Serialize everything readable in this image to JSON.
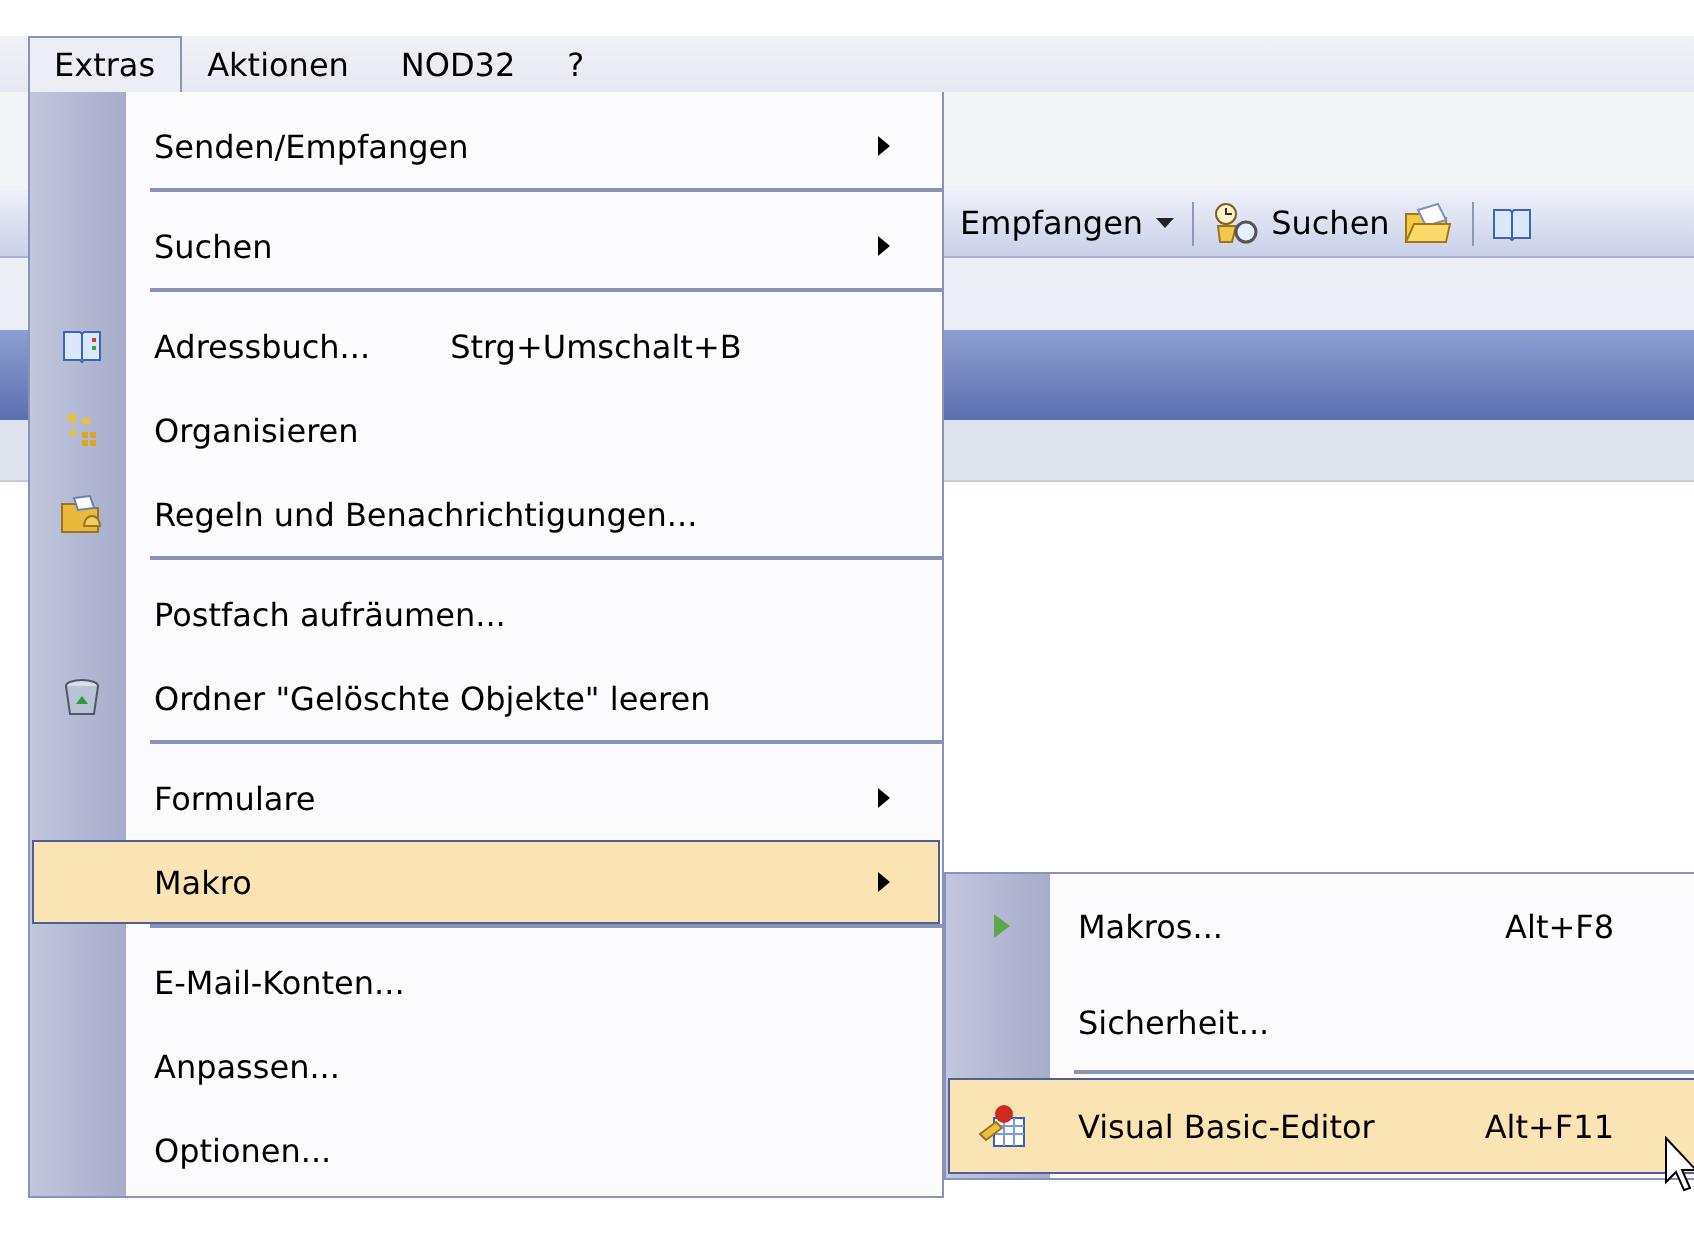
{
  "menubar": [
    {
      "label": "Extras",
      "selected": true
    },
    {
      "label": "Aktionen",
      "selected": false
    },
    {
      "label": "NOD32",
      "selected": false
    },
    {
      "label": "?",
      "selected": false
    }
  ],
  "toolbar": {
    "receive_label": "Empfangen",
    "search_label": "Suchen"
  },
  "menu": [
    {
      "label": "Senden/Empfangen",
      "kind": "submenu",
      "selected": false,
      "separator_after": true
    },
    {
      "label": "Suchen",
      "kind": "submenu",
      "selected": false,
      "separator_after": true
    },
    {
      "label": "Adressbuch...",
      "shortcut": "Strg+Umschalt+B",
      "kind": "command",
      "selected": false,
      "separator_after": false
    },
    {
      "label": "Organisieren",
      "kind": "command",
      "selected": false,
      "separator_after": false
    },
    {
      "label": "Regeln und Benachrichtigungen...",
      "kind": "command",
      "selected": false,
      "separator_after": true
    },
    {
      "label": "Postfach aufräumen...",
      "kind": "command",
      "selected": false,
      "separator_after": false
    },
    {
      "label": "Ordner \"Gelöschte Objekte\" leeren",
      "kind": "command",
      "selected": false,
      "separator_after": true
    },
    {
      "label": "Formulare",
      "kind": "submenu",
      "selected": false,
      "separator_after": false
    },
    {
      "label": "Makro",
      "kind": "submenu",
      "selected": true,
      "separator_after": true
    },
    {
      "label": "E-Mail-Konten...",
      "kind": "command",
      "selected": false,
      "separator_after": false
    },
    {
      "label": "Anpassen...",
      "kind": "command",
      "selected": false,
      "separator_after": false
    },
    {
      "label": "Optionen...",
      "kind": "command",
      "selected": false,
      "separator_after": false
    }
  ],
  "submenu": [
    {
      "label": "Makros...",
      "shortcut": "Alt+F8",
      "selected": false,
      "separator_after": false
    },
    {
      "label": "Sicherheit...",
      "selected": false,
      "separator_after": true
    },
    {
      "label": "Visual Basic-Editor",
      "shortcut": "Alt+F11",
      "selected": true,
      "separator_after": false
    }
  ]
}
